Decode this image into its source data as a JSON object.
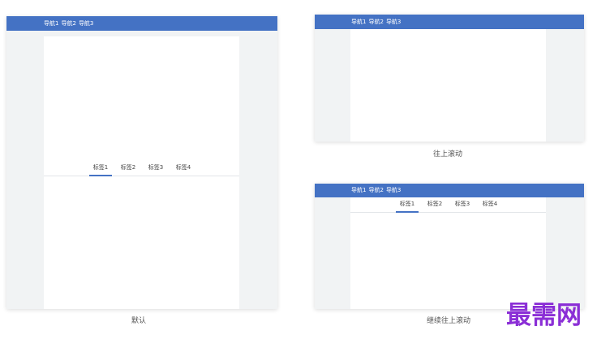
{
  "panels": {
    "default": {
      "nav": [
        "导航1",
        "导航2",
        "导航3"
      ],
      "tabs": [
        "标签1",
        "标签2",
        "标签3",
        "标签4"
      ],
      "active_tab_index": 0,
      "caption": "默认"
    },
    "scroll_up": {
      "nav": [
        "导航1",
        "导航2",
        "导航3"
      ],
      "caption": "往上滚动"
    },
    "scroll_further": {
      "nav": [
        "导航1",
        "导航2",
        "导航3"
      ],
      "tabs": [
        "标签1",
        "标签2",
        "标签3",
        "标签4"
      ],
      "active_tab_index": 0,
      "caption": "继续往上滚动"
    }
  },
  "watermark": "最需网",
  "colors": {
    "header": "#4472c4",
    "side_background": "#f1f3f4",
    "content_background": "#ffffff",
    "accent": "#4472c4",
    "tab_text": "#444444",
    "caption_text": "#555555",
    "watermark": "#8b2fd6"
  }
}
